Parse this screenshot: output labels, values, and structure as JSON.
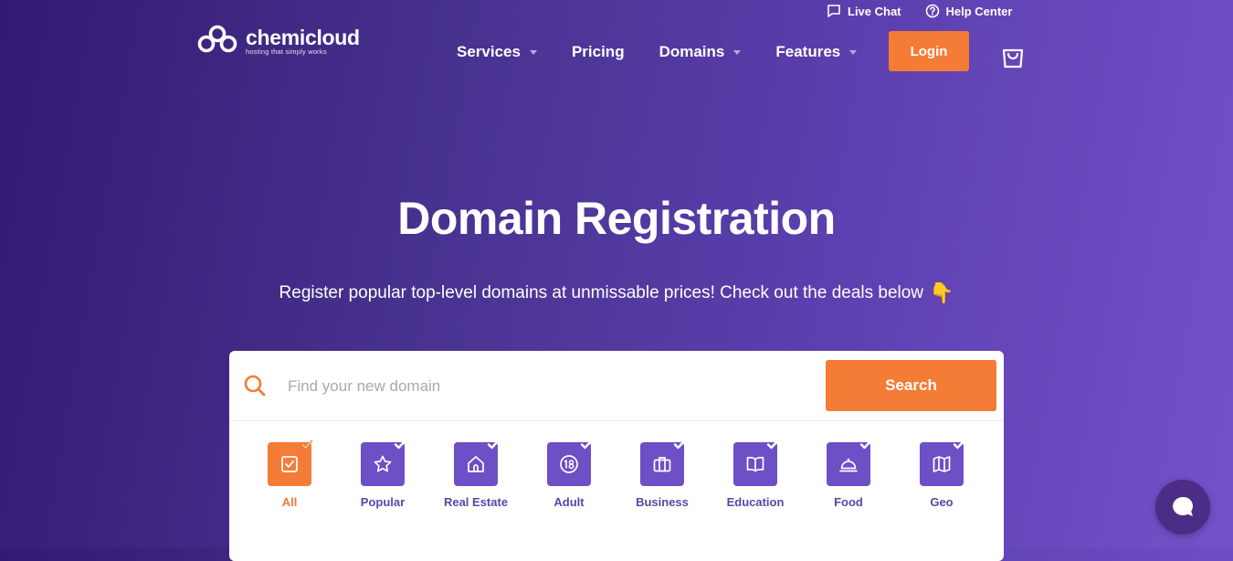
{
  "brand": {
    "name": "chemicloud",
    "tagline": "hosting that simply works"
  },
  "topbar": {
    "live_chat": "Live Chat",
    "help_center": "Help Center"
  },
  "nav": [
    {
      "label": "Services",
      "dropdown": true
    },
    {
      "label": "Pricing",
      "dropdown": false
    },
    {
      "label": "Domains",
      "dropdown": true
    },
    {
      "label": "Features",
      "dropdown": true
    }
  ],
  "login_label": "Login",
  "hero": {
    "title": "Domain Registration",
    "subtitle": "Register popular top-level domains at unmissable prices! Check out the deals below",
    "emoji": "👇"
  },
  "search": {
    "placeholder": "Find your new domain",
    "value": "",
    "button": "Search"
  },
  "categories": [
    {
      "label": "All",
      "icon": "checkbox-icon",
      "active": true
    },
    {
      "label": "Popular",
      "icon": "star-icon",
      "active": false
    },
    {
      "label": "Real Estate",
      "icon": "house-icon",
      "active": false
    },
    {
      "label": "Adult",
      "icon": "eighteen-icon",
      "active": false
    },
    {
      "label": "Business",
      "icon": "briefcase-icon",
      "active": false
    },
    {
      "label": "Education",
      "icon": "book-icon",
      "active": false
    },
    {
      "label": "Food",
      "icon": "cloche-icon",
      "active": false
    },
    {
      "label": "Geo",
      "icon": "map-icon",
      "active": false
    }
  ],
  "colors": {
    "accent": "#f57c36",
    "purple": "#6d4fc6",
    "chat": "#4b2d85"
  }
}
